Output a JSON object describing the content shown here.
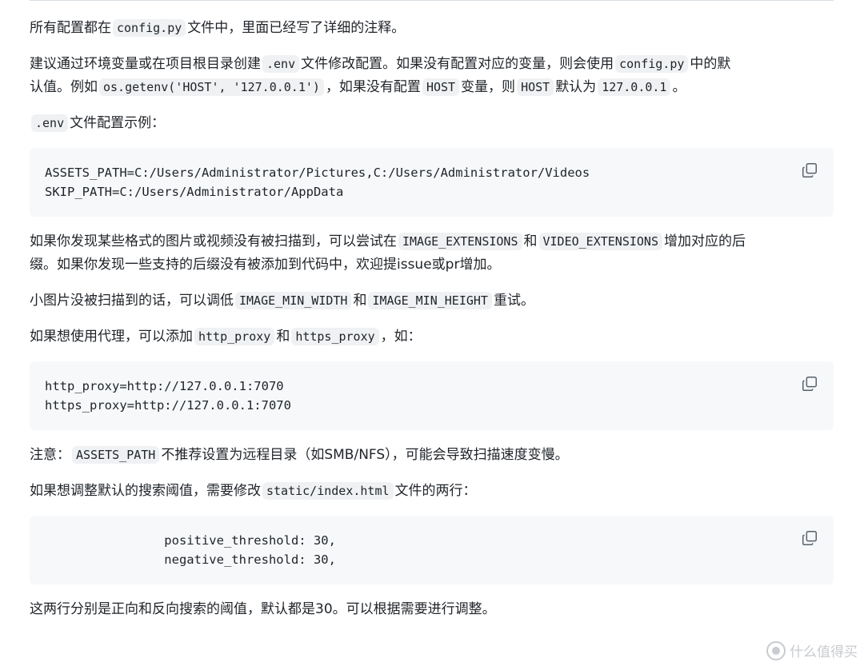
{
  "paragraphs": {
    "p1": {
      "t1": "所有配置都在",
      "c1": "config.py",
      "t2": "文件中，里面已经写了详细的注释。"
    },
    "p2": {
      "t1": "建议通过环境变量或在项目根目录创建",
      "c1": ".env",
      "t2": "文件修改配置。如果没有配置对应的变量，则会使用",
      "c2": "config.py",
      "t3": "中的默",
      "t4": "认值。例如",
      "c3": "os.getenv('HOST', '127.0.0.1')",
      "t5": "，如果没有配置",
      "c4": "HOST",
      "t6": "变量，则",
      "c5": "HOST",
      "t7": "默认为",
      "c6": "127.0.0.1",
      "t8": "。"
    },
    "p3": {
      "c1": ".env",
      "t1": "文件配置示例："
    },
    "p4": {
      "t1": "如果你发现某些格式的图片或视频没有被扫描到，可以尝试在",
      "c1": "IMAGE_EXTENSIONS",
      "t2": "和",
      "c2": "VIDEO_EXTENSIONS",
      "t3": "增加对应的后",
      "t4": "缀。如果你发现一些支持的后缀没有被添加到代码中，欢迎提issue或pr增加。"
    },
    "p5": {
      "t1": "小图片没被扫描到的话，可以调低",
      "c1": "IMAGE_MIN_WIDTH",
      "t2": "和",
      "c2": "IMAGE_MIN_HEIGHT",
      "t3": "重试。"
    },
    "p6": {
      "t1": "如果想使用代理，可以添加",
      "c1": "http_proxy",
      "t2": "和",
      "c2": "https_proxy",
      "t3": "，如："
    },
    "p7": {
      "t1": "注意：",
      "c1": "ASSETS_PATH",
      "t2": "不推荐设置为远程目录（如SMB/NFS），可能会导致扫描速度变慢。"
    },
    "p8": {
      "t1": "如果想调整默认的搜索阈值，需要修改",
      "c1": "static/index.html",
      "t2": "文件的两行："
    },
    "p9": {
      "t1": "这两行分别是正向和反向搜索的阈值，默认都是30。可以根据需要进行调整。"
    }
  },
  "code_blocks": {
    "env_example": "ASSETS_PATH=C:/Users/Administrator/Pictures,C:/Users/Administrator/Videos\nSKIP_PATH=C:/Users/Administrator/AppData",
    "proxy_example": "http_proxy=http://127.0.0.1:7070\nhttps_proxy=http://127.0.0.1:7070",
    "threshold_example": "                positive_threshold: 30,\n                negative_threshold: 30,"
  },
  "icons": {
    "copy": "copy-icon",
    "watermark_logo": "zhi-logo-icon"
  },
  "watermark": {
    "text": "什么值得买"
  }
}
